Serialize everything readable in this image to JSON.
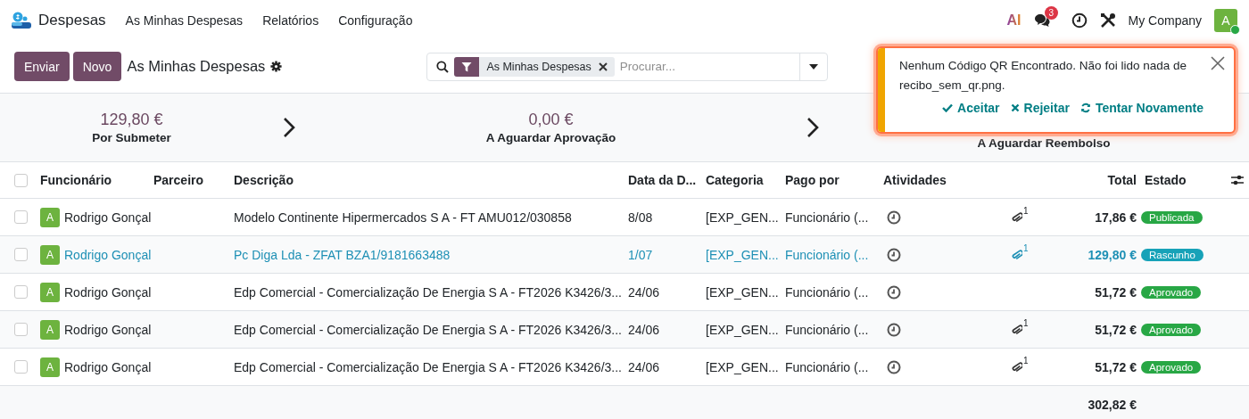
{
  "navbar": {
    "app_name": "Despesas",
    "menu": [
      "As Minhas Despesas",
      "Relatórios",
      "Configuração"
    ],
    "ai_label": "AI",
    "messages_badge": "3",
    "company": "My Company",
    "avatar": "A"
  },
  "control_panel": {
    "buttons": [
      "Enviar",
      "Novo"
    ],
    "title": "As Minhas Despesas",
    "search": {
      "facet": "As Minhas Despesas",
      "placeholder": "Procurar..."
    }
  },
  "stats": [
    {
      "amount": "129,80 €",
      "label": "Por Submeter"
    },
    {
      "amount": "0,00 €",
      "label": "A Aguardar Aprovação"
    },
    {
      "label": "A Aguardar Reembolso"
    }
  ],
  "table": {
    "columns": [
      "Funcionário",
      "Parceiro",
      "Descrição",
      "Data da D...",
      "Categoria",
      "Pago por",
      "Atividades",
      "Total",
      "Estado"
    ],
    "all_checked": false,
    "rows": [
      {
        "employee": "Rodrigo Gonçal",
        "avatar": "A",
        "description": "Modelo Continente Hipermercados S A - FT AMU012/030858",
        "date": "8/08",
        "category": "[EXP_GEN...",
        "paid_by": "Funcionário (...",
        "attachments": "1",
        "total": "17,86 €",
        "status": "Publicada",
        "color": "#28a745",
        "draft": false,
        "checked": false
      },
      {
        "employee": "Rodrigo Gonçal",
        "avatar": "A",
        "description": "Pc Diga Lda - ZFAT BZA1/9181663488",
        "date": "1/07",
        "category": "[EXP_GEN...",
        "paid_by": "Funcionário (...",
        "attachments": "1",
        "total": "129,80 €",
        "status": "Rascunho",
        "color": "#17a2b8",
        "draft": true,
        "checked": false
      },
      {
        "employee": "Rodrigo Gonçal",
        "avatar": "A",
        "description": "Edp Comercial - Comercialização De Energia S A - FT2026 K3426/3...",
        "date": "24/06",
        "category": "[EXP_GEN...",
        "paid_by": "Funcionário (...",
        "total": "51,72 €",
        "status": "Aprovado",
        "color": "#28a745",
        "draft": false,
        "checked": false
      },
      {
        "employee": "Rodrigo Gonçal",
        "avatar": "A",
        "description": "Edp Comercial - Comercialização De Energia S A - FT2026 K3426/3...",
        "date": "24/06",
        "category": "[EXP_GEN...",
        "paid_by": "Funcionário (...",
        "attachments": "1",
        "total": "51,72 €",
        "status": "Aprovado",
        "color": "#28a745",
        "draft": false,
        "checked": false
      },
      {
        "employee": "Rodrigo Gonçal",
        "avatar": "A",
        "description": "Edp Comercial - Comercialização De Energia S A - FT2026 K3426/3...",
        "date": "24/06",
        "category": "[EXP_GEN...",
        "paid_by": "Funcionário (...",
        "attachments": "1",
        "total": "51,72 €",
        "status": "Aprovado",
        "color": "#28a745",
        "draft": false,
        "checked": false
      }
    ],
    "footer_total": "302,82 €"
  },
  "notification": {
    "message": "Nenhum Código QR Encontrado. Não foi lido nada de recibo_sem_qr.png.",
    "actions": [
      {
        "kind": "accept",
        "label": "Aceitar"
      },
      {
        "kind": "reject",
        "label": "Rejeitar"
      },
      {
        "kind": "retry",
        "label": "Tentar Novamente"
      }
    ]
  }
}
